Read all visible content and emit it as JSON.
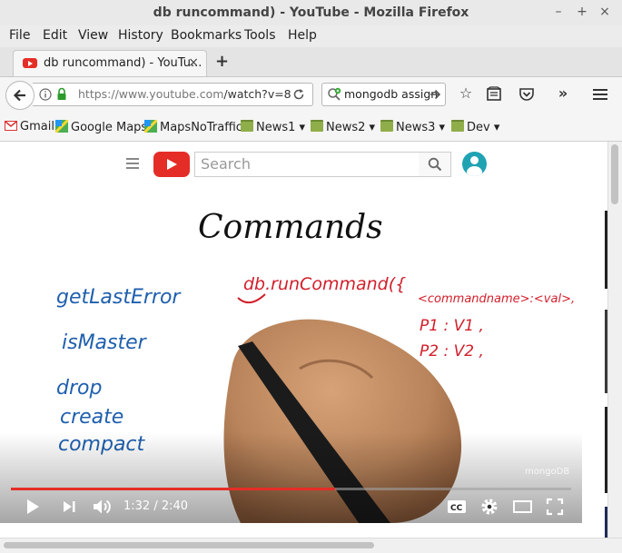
{
  "window": {
    "title": "db runcommand) - YouTube - Mozilla Firefox"
  },
  "menu": {
    "file": "File",
    "edit": "Edit",
    "view": "View",
    "history": "History",
    "bookmarks": "Bookmarks",
    "tools": "Tools",
    "help": "Help"
  },
  "tab": {
    "title": "db runcommand) - YouTu...",
    "close": "×",
    "new": "+"
  },
  "nav": {
    "url_host": "https://www.youtube.com",
    "url_path": "/watch?v=8",
    "search_value": "mongodb assign"
  },
  "bookmarks": [
    {
      "label": "Gmail",
      "icon": "gmail-icon"
    },
    {
      "label": "Google Maps",
      "icon": "maps-icon"
    },
    {
      "label": "MapsNoTraffic",
      "icon": "maps-icon"
    },
    {
      "label": "News1",
      "icon": "folder-icon"
    },
    {
      "label": "News2",
      "icon": "folder-icon"
    },
    {
      "label": "News3",
      "icon": "folder-icon"
    },
    {
      "label": "Dev",
      "icon": "folder-icon"
    }
  ],
  "youtube": {
    "search_placeholder": "Search",
    "video": {
      "time": "1:32 / 2:40",
      "progress": 0.578,
      "watermark": "mongoDB",
      "whiteboard": {
        "title": "Commands",
        "left_list": [
          "getLastError",
          "isMaster",
          "drop",
          "create",
          "compact"
        ],
        "call": "db.runCommand({",
        "args": [
          "<commandname>:<val>,",
          "P1 : V1 ,",
          "P2 : V2 ,"
        ]
      }
    }
  },
  "colors": {
    "accent": "#e52d27",
    "ink_blue": "#1f5fae",
    "ink_red": "#d11f2b",
    "ink_black": "#111111"
  }
}
